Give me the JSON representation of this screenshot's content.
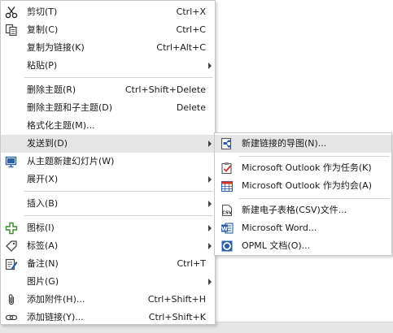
{
  "main_menu": {
    "items": [
      {
        "label": "剪切(T)",
        "shortcut": "Ctrl+X"
      },
      {
        "label": "复制(C)",
        "shortcut": "Ctrl+C"
      },
      {
        "label": "复制为链接(K)",
        "shortcut": "Ctrl+Alt+C"
      },
      {
        "label": "粘贴(P)",
        "shortcut": ""
      },
      {
        "label": "删除主题(R)",
        "shortcut": "Ctrl+Shift+Delete"
      },
      {
        "label": "删除主题和子主题(D)",
        "shortcut": "Delete"
      },
      {
        "label": "格式化主题(M)...",
        "shortcut": ""
      },
      {
        "label": "发送到(D)",
        "shortcut": ""
      },
      {
        "label": "从主题新建幻灯片(W)",
        "shortcut": ""
      },
      {
        "label": "展开(X)",
        "shortcut": ""
      },
      {
        "label": "插入(B)",
        "shortcut": ""
      },
      {
        "label": "图标(I)",
        "shortcut": ""
      },
      {
        "label": "标签(A)",
        "shortcut": ""
      },
      {
        "label": "备注(N)",
        "shortcut": "Ctrl+T"
      },
      {
        "label": "图片(G)",
        "shortcut": ""
      },
      {
        "label": "添加附件(H)...",
        "shortcut": "Ctrl+Shift+H"
      },
      {
        "label": "添加链接(Y)...",
        "shortcut": "Ctrl+Shift+K"
      }
    ]
  },
  "send_to_submenu": {
    "items": [
      {
        "label": "新建链接的导图(N)..."
      },
      {
        "label": "Microsoft Outlook 作为任务(K)"
      },
      {
        "label": "Microsoft Outlook 作为约会(A)"
      },
      {
        "label": "新建电子表格(CSV)文件..."
      },
      {
        "label": "Microsoft Word..."
      },
      {
        "label": "OPML 文档(O)..."
      }
    ]
  },
  "colors": {
    "highlight": "#e5e5e5",
    "separator": "#d4d4d4",
    "icon_blue": "#2b5fa8",
    "icon_red": "#d0342c"
  },
  "icons": [
    "scissors-icon",
    "copy-icon",
    "new-slide-icon",
    "icon-icon",
    "tag-icon",
    "note-icon",
    "paperclip-icon",
    "link-icon",
    "linked-map-icon",
    "outlook-task-icon",
    "outlook-appointment-icon",
    "csv-icon",
    "word-icon",
    "opml-icon"
  ]
}
